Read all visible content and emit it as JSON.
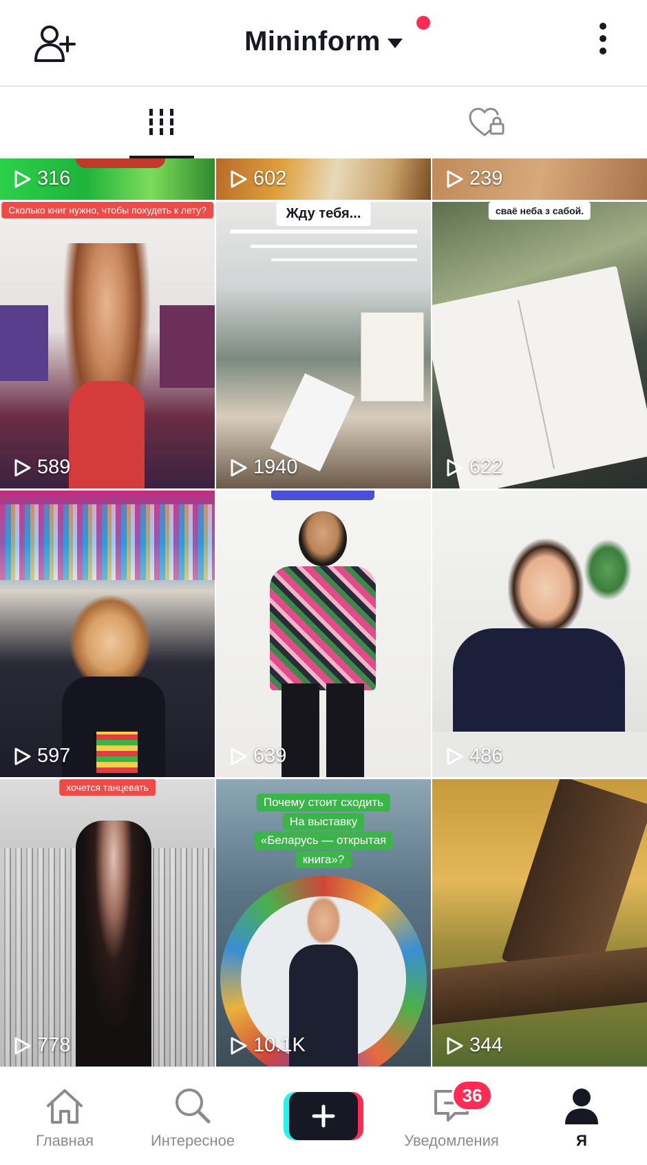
{
  "header": {
    "title": "Mininform",
    "add_friend_icon": "add-user-icon",
    "menu_icon": "more-vertical-icon"
  },
  "tabs": [
    {
      "name": "videos",
      "icon": "grid-icon",
      "active": true
    },
    {
      "name": "liked",
      "icon": "heart-lock-icon",
      "active": false
    }
  ],
  "videos": [
    {
      "views": "316"
    },
    {
      "views": "602"
    },
    {
      "views": "239"
    },
    {
      "views": "589",
      "caption": "Сколько книг нужно, чтобы похудеть к лету?"
    },
    {
      "views": "1940",
      "caption": "Жду тебя..."
    },
    {
      "views": "622",
      "caption": "сваё неба з сабой."
    },
    {
      "views": "597"
    },
    {
      "views": "639"
    },
    {
      "views": "486"
    },
    {
      "views": "778",
      "caption": "хочется танцевать"
    },
    {
      "views": "10.1K",
      "caption": [
        "Почему стоит сходить",
        "На выставку",
        "«Беларусь — открытая",
        "книга»?"
      ]
    },
    {
      "views": "344"
    }
  ],
  "bottom_nav": {
    "home": {
      "label": "Главная",
      "icon": "home-icon"
    },
    "discover": {
      "label": "Интересное",
      "icon": "search-icon"
    },
    "create": {
      "icon": "plus-icon"
    },
    "inbox": {
      "label": "Уведомления",
      "icon": "message-icon",
      "badge": "36"
    },
    "me": {
      "label": "Я",
      "icon": "profile-icon",
      "active": true
    }
  },
  "colors": {
    "accent_red": "#fe2c55",
    "accent_cyan": "#25f4ee",
    "text_dark": "#161823",
    "text_muted": "#8a8b91"
  }
}
